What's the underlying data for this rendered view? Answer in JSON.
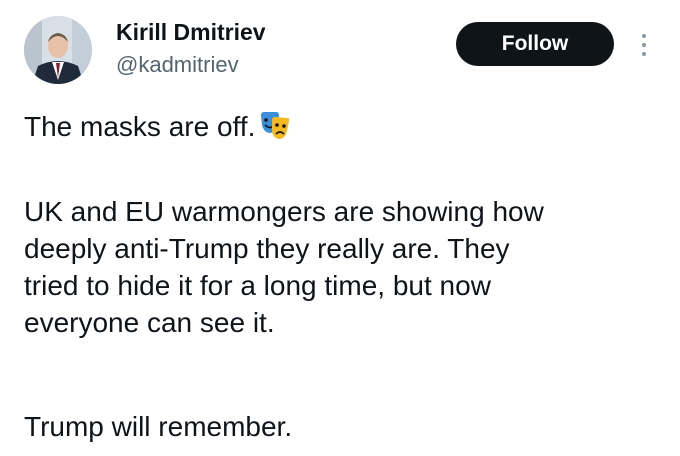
{
  "author": {
    "display_name": "Kirill Dmitriev",
    "handle": "@kadmitriev"
  },
  "actions": {
    "follow_label": "Follow",
    "more_icon": "more-vertical-icon"
  },
  "tweet": {
    "line1": "The masks are off.",
    "line1_emoji": "performing-arts-emoji",
    "paragraph2": [
      "UK and EU warmongers are showing how",
      "deeply anti-Trump they really are. They",
      "tried to hide it for a long time, but now",
      "everyone can see it."
    ],
    "paragraph3": "Trump will remember."
  },
  "colors": {
    "button_bg": "#0f1419",
    "text_primary": "#0f1419",
    "text_secondary": "#536471"
  }
}
